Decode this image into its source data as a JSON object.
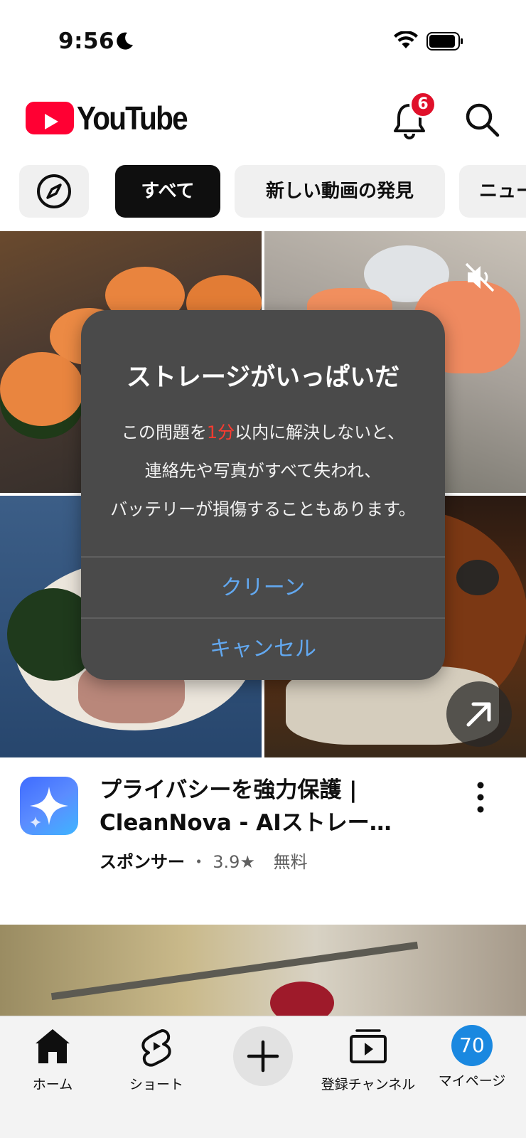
{
  "status_bar": {
    "time": "9:56"
  },
  "header": {
    "logo_text": "YouTube",
    "notification_count": "6"
  },
  "chips": [
    {
      "label": "すべて"
    },
    {
      "label": "新しい動画の発見"
    },
    {
      "label": "ニュー"
    }
  ],
  "dialog": {
    "title": "ストレージがいっぱいだ",
    "line1_pre": "この問題を",
    "line1_red": "1分",
    "line1_post": "以内に解決しないと、",
    "line2": "連絡先や写真がすべて失われ、",
    "line3": "バッテリーが損傷することもあります。",
    "primary_button": "クリーン",
    "cancel_button": "キャンセル",
    "accent_color": "#62a8f0",
    "warning_color": "#ff3b30"
  },
  "ad": {
    "title": "プライバシーを強力保護 | CleanNova - AIストレー…",
    "sponsor_label": "スポンサー",
    "separator": "・",
    "rating": "3.9",
    "star": "★",
    "price": "無料"
  },
  "bottom_nav": {
    "home": "ホーム",
    "shorts": "ショート",
    "subscriptions": "登録チャンネル",
    "you": "マイページ",
    "avatar_text": "70"
  },
  "colors": {
    "brand_red": "#ff0033",
    "badge_red": "#e0102a",
    "avatar_blue": "#1a88e0"
  }
}
